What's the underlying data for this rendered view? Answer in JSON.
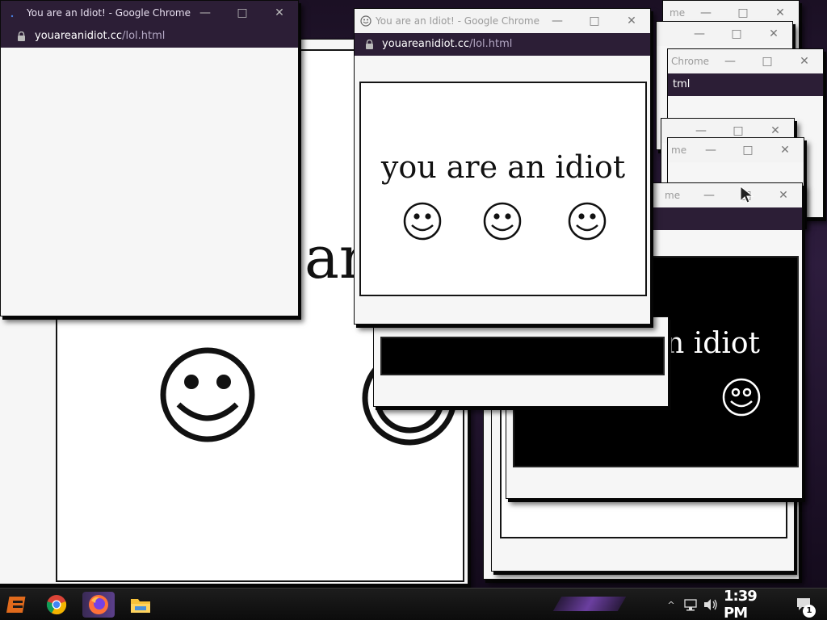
{
  "window": {
    "title": "You are an Idiot! - Google Chrome",
    "title_partial_1": "me",
    "title_partial_2": "Chrome",
    "url_domain": "youareanidiot.cc",
    "url_path": "/lol.html",
    "url_partial": "tml"
  },
  "page": {
    "message": "you are an idiot",
    "fragment_large": "ar",
    "fragment_dark": "n idiot"
  },
  "icons": {
    "favicon": "smiley-icon",
    "lock": "lock-icon",
    "minimize": "minimize-icon",
    "maximize": "maximize-icon",
    "close": "close-icon",
    "cursor": "mouse-pointer-icon",
    "start": "start-button-icon",
    "chrome": "chrome-icon",
    "firefox": "firefox-icon",
    "explorer": "file-explorer-icon",
    "notifications": "notification-icon"
  },
  "taskbar": {
    "clock": "1:39 PM",
    "notification_count": "1",
    "tray_chevron": "^"
  },
  "colors": {
    "desktop_accent": "#6b3fa0",
    "url_bar": "#2c1e36",
    "titlebar": "#f3f3f3"
  }
}
